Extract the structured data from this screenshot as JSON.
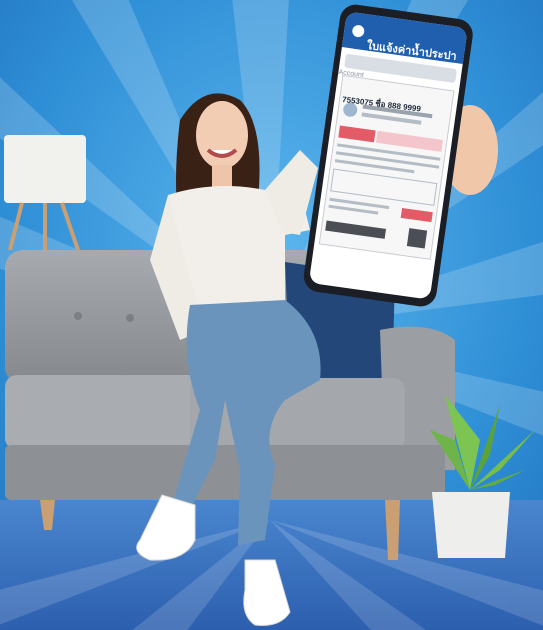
{
  "phone": {
    "title": "ใบแจ้งค่าน้ำประปา",
    "search_label": "Account",
    "meter_number": "7553075  ชื่อ 888 9999"
  },
  "colors": {
    "background_blue": "#2f8fd6",
    "floor_blue": "#3a72c4",
    "sofa_gray": "#9a9ea3",
    "app_header_blue": "#1f5fae"
  }
}
